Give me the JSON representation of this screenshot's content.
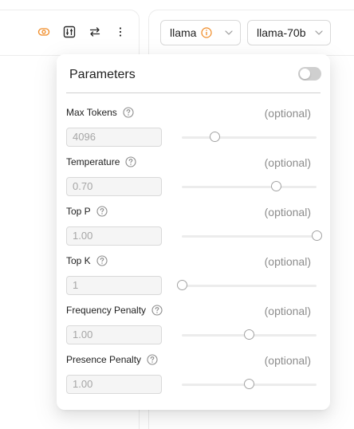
{
  "right_toolbar": {
    "model_provider": "llama",
    "model_name": "llama-70b"
  },
  "icons": {
    "toggle_view": "eye-icon",
    "parameters": "sliders-icon",
    "swap": "swap-arrows-icon",
    "more": "more-vertical-icon",
    "info": "info-icon",
    "chevron": "chevron-down-icon",
    "help": "question-circle-icon"
  },
  "colors": {
    "accent": "#f08a24",
    "muted": "#8c8c8c"
  },
  "parameters_panel": {
    "title": "Parameters",
    "enabled": false,
    "items": [
      {
        "label": "Max Tokens",
        "value": "4096",
        "optional": "(optional)",
        "level": 0.245
      },
      {
        "label": "Temperature",
        "value": "0.70",
        "optional": "(optional)",
        "level": 0.7
      },
      {
        "label": "Top P",
        "value": "1.00",
        "optional": "(optional)",
        "level": 1.0
      },
      {
        "label": "Top K",
        "value": "1",
        "optional": "(optional)",
        "level": 0.0
      },
      {
        "label": "Frequency Penalty",
        "value": "1.00",
        "optional": "(optional)",
        "level": 0.5
      },
      {
        "label": "Presence Penalty",
        "value": "1.00",
        "optional": "(optional)",
        "level": 0.5
      }
    ]
  }
}
